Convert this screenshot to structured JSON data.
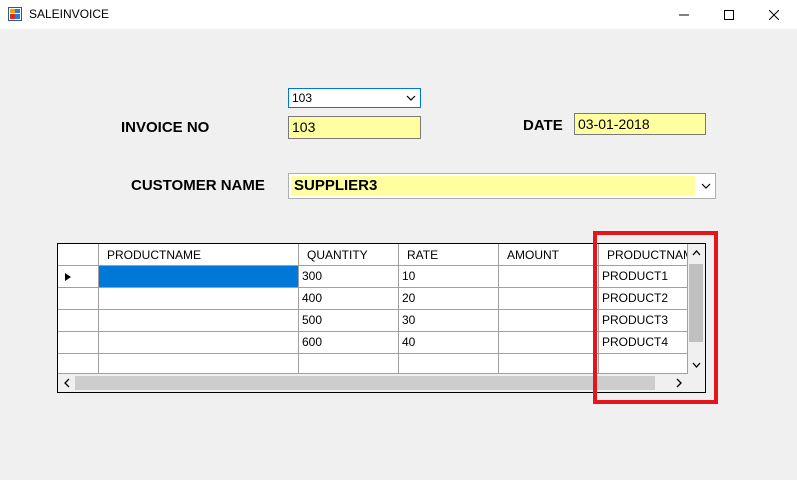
{
  "window": {
    "title": "SALEINVOICE"
  },
  "form": {
    "invoice_combo_value": "103",
    "invoice_label": "INVOICE NO",
    "invoice_value": "103",
    "date_label": "DATE",
    "date_value": "03-01-2018",
    "customer_label": "CUSTOMER NAME",
    "customer_value": "SUPPLIER3"
  },
  "grid": {
    "columns": [
      "PRODUCTNAME",
      "QUANTITY",
      "RATE",
      "AMOUNT",
      "PRODUCTNAME"
    ],
    "rows": [
      [
        "",
        "300",
        "10",
        "",
        "PRODUCT1"
      ],
      [
        "",
        "400",
        "20",
        "",
        "PRODUCT2"
      ],
      [
        "",
        "500",
        "30",
        "",
        "PRODUCT3"
      ],
      [
        "",
        "600",
        "40",
        "",
        "PRODUCT4"
      ],
      [
        "",
        "",
        "",
        "",
        ""
      ]
    ]
  },
  "colors": {
    "highlight": "#e3161d",
    "input_bg": "#ffffa0",
    "selection": "#0078d7"
  }
}
